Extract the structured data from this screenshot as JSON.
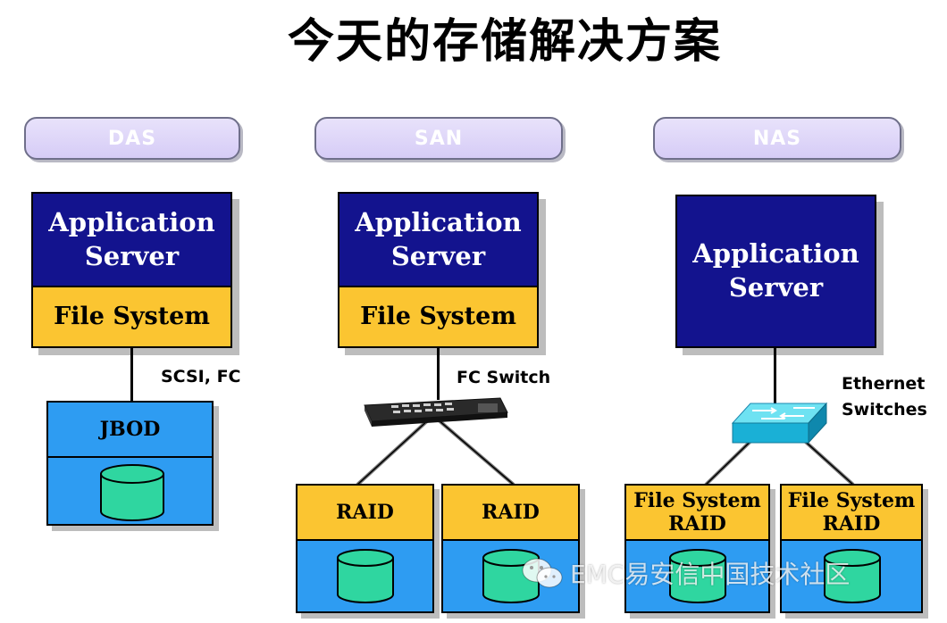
{
  "title": "今天的存储解决方案",
  "columns": [
    {
      "header": "DAS",
      "server": {
        "line1": "Application",
        "line2": "Server",
        "fs": "File System"
      },
      "link_label": "SCSI, FC",
      "storage": {
        "label": "JBOD"
      }
    },
    {
      "header": "SAN",
      "server": {
        "line1": "Application",
        "line2": "Server",
        "fs": "File System"
      },
      "link_label": "FC Switch",
      "storage": [
        {
          "label": "RAID"
        },
        {
          "label": "RAID"
        }
      ]
    },
    {
      "header": "NAS",
      "server": {
        "line1": "Application",
        "line2": "Server"
      },
      "link_label_1": "Ethernet",
      "link_label_2": "Switches",
      "storage": [
        {
          "line1": "File System",
          "line2": "RAID"
        },
        {
          "line1": "File System",
          "line2": "RAID"
        }
      ]
    }
  ],
  "watermark": "EMC易安信中国技术社区",
  "colors": {
    "navy": "#13138e",
    "yellow": "#fbc531",
    "blue": "#2e9cf2",
    "disk": "#2fd6a0",
    "pill": "#d9d0f7"
  }
}
